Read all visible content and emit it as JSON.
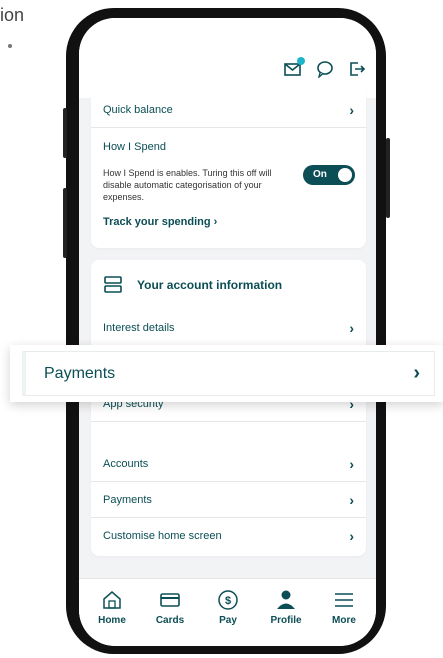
{
  "background_fragment": {
    "text": "ion"
  },
  "header": {
    "icons": [
      "envelope-icon",
      "chat-icon",
      "logout-icon"
    ],
    "notification_color": "#1fb5c9"
  },
  "card1": {
    "quick_balance": "Quick balance",
    "how_i_spend": {
      "title": "How I Spend",
      "description": "How I Spend is enables. Turing this off will disable automatic categorisation of your expenses.",
      "toggle_label": "On",
      "toggle_on": true
    },
    "track_link": "Track your spending"
  },
  "account_info": {
    "title": "Your account information",
    "items": [
      {
        "label": "Interest details"
      },
      {
        "label": "App security"
      },
      {
        "label": "Accounts"
      },
      {
        "label": "Payments"
      },
      {
        "label": "Customise home screen"
      }
    ]
  },
  "zoom_popover": {
    "label": "Payments"
  },
  "bottom_nav": {
    "items": [
      {
        "label": "Home",
        "icon": "home-icon"
      },
      {
        "label": "Cards",
        "icon": "card-icon"
      },
      {
        "label": "Pay",
        "icon": "dollar-icon"
      },
      {
        "label": "Profile",
        "icon": "profile-icon"
      },
      {
        "label": "More",
        "icon": "menu-icon"
      }
    ]
  },
  "colors": {
    "accent": "#0b4e55",
    "background": "#f2f3f4"
  }
}
